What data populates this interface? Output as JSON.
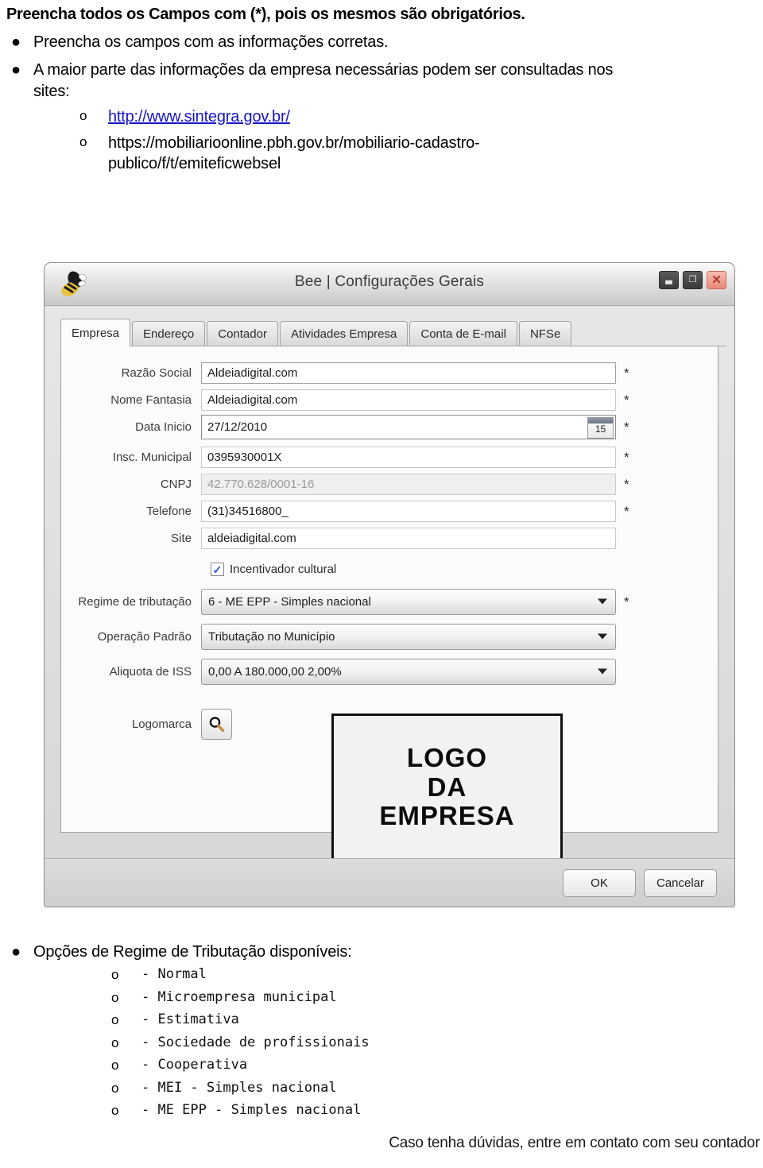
{
  "document": {
    "heading": "Preencha todos os Campos com (*), pois os mesmos são obrigatórios.",
    "bullet_marker": "●",
    "sub_marker": "o",
    "bullets": [
      {
        "text": "Preencha os campos com as informações corretas."
      },
      {
        "text": "A maior parte das informações da empresa necessárias podem ser consultadas nos sites:"
      }
    ],
    "links": [
      {
        "text": "http://www.sintegra.gov.br/",
        "is_link": true
      },
      {
        "text": "https://mobiliarioonline.pbh.gov.br/mobiliario-cadastro-publico/f/t/emiteficwebsel",
        "is_link": false
      }
    ],
    "options_heading": "Opções de Regime de Tributação disponíveis:",
    "regime_options": [
      "- Normal",
      "- Microempresa municipal",
      "- Estimativa",
      "- Sociedade de profissionais",
      "- Cooperativa",
      "- MEI - Simples nacional",
      "- ME EPP - Simples nacional"
    ],
    "footer_note": "Caso tenha dúvidas, entre em contato com seu contador"
  },
  "app": {
    "title": "Bee | Configurações Gerais",
    "app_icon": "bee-icon",
    "window_buttons": [
      {
        "name": "minimize",
        "glyph": "▃"
      },
      {
        "name": "restore",
        "glyph": "❐"
      },
      {
        "name": "close",
        "glyph": "✕"
      }
    ],
    "tabs": [
      {
        "label": "Empresa",
        "active": true
      },
      {
        "label": "Endereço",
        "active": false
      },
      {
        "label": "Contador",
        "active": false
      },
      {
        "label": "Atividades Empresa",
        "active": false
      },
      {
        "label": "Conta de E-mail",
        "active": false
      },
      {
        "label": "NFSe",
        "active": false
      }
    ],
    "required_marker": "*",
    "fields": [
      {
        "label": "Razão Social",
        "value": "Aldeiadigital.com",
        "required": true,
        "state": "focused"
      },
      {
        "label": "Nome Fantasia",
        "value": "Aldeiadigital.com",
        "required": true,
        "state": "normal"
      },
      {
        "label": "Data Inicio",
        "value": "27/12/2010",
        "required": true,
        "state": "date",
        "calendar_day": "15"
      },
      {
        "label": "Insc. Municipal",
        "value": "0395930001X",
        "required": true,
        "state": "normal"
      },
      {
        "label": "CNPJ",
        "value": "42.770.628/0001-16",
        "required": true,
        "state": "disabled"
      },
      {
        "label": "Telefone",
        "value": "(31)34516800_",
        "required": true,
        "state": "normal"
      },
      {
        "label": "Site",
        "value": "aldeiadigital.com",
        "required": false,
        "state": "normal"
      }
    ],
    "checkbox": {
      "label": "Incentivador cultural",
      "checked": true,
      "tick": "✓"
    },
    "selects": [
      {
        "label": "Regime de tributação",
        "value": "6 - ME EPP - Simples nacional",
        "required": true
      },
      {
        "label": "Operação Padrão",
        "value": "Tributação no Município",
        "required": false
      },
      {
        "label": "Aliquota de ISS",
        "value": "0,00 A 180.000,00 2,00%",
        "required": false
      }
    ],
    "logo": {
      "label": "Logomarca",
      "browse_icon": "magnifier-icon",
      "preview_lines": [
        "LOGO",
        "DA",
        "EMPRESA"
      ]
    },
    "footer_buttons": [
      {
        "label": "OK"
      },
      {
        "label": "Cancelar"
      }
    ]
  },
  "colors": {
    "link": "#1616c8",
    "checkbox_tick": "#2a4fd0",
    "close_button": "#e9897a"
  }
}
